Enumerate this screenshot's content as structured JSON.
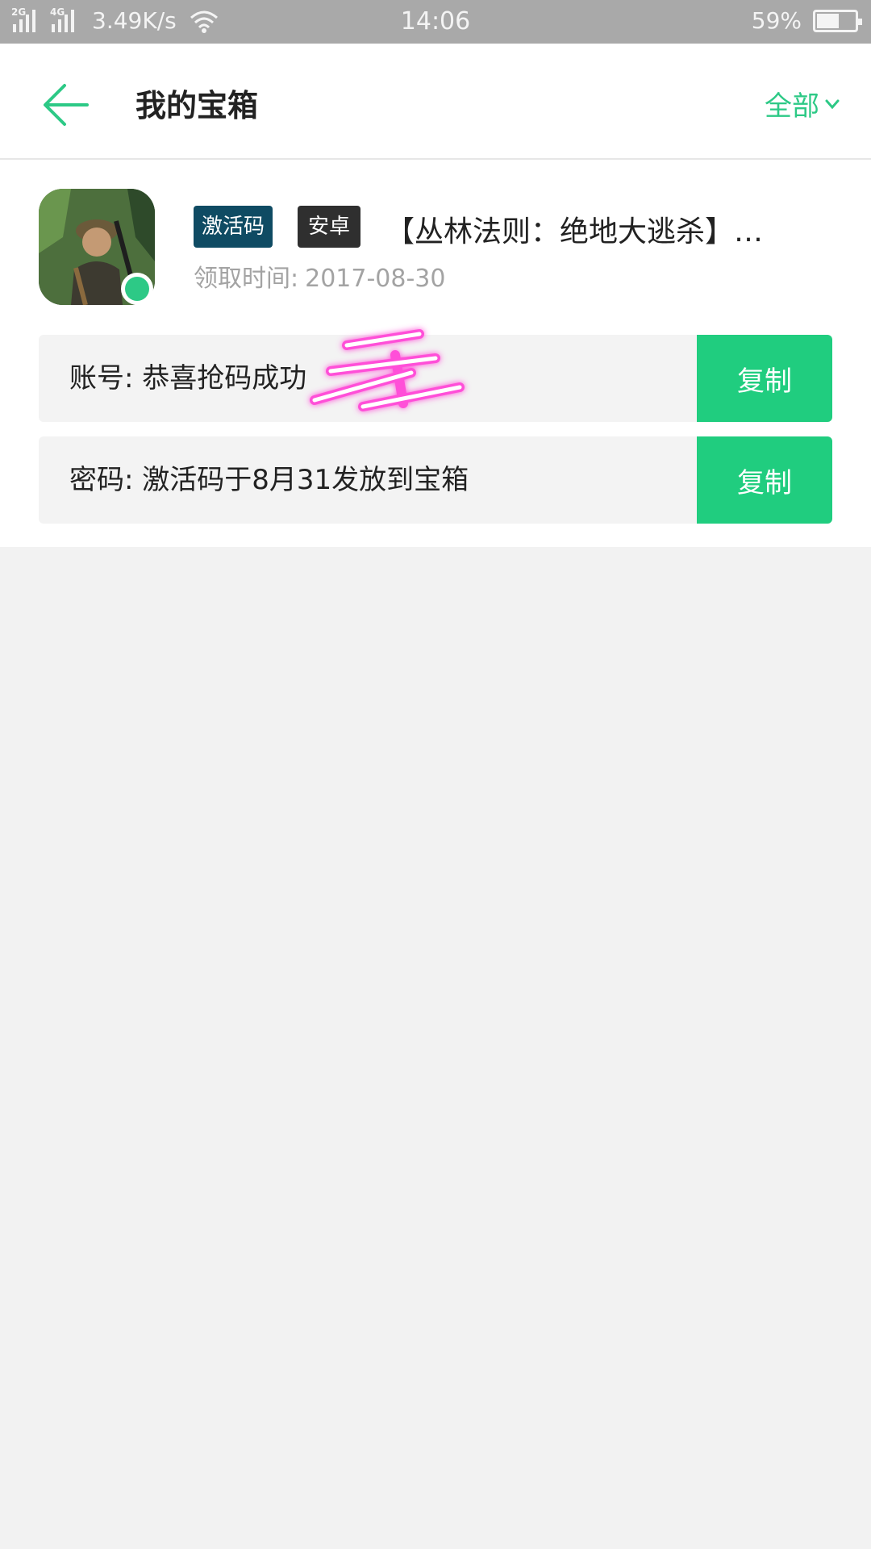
{
  "status_bar": {
    "sim1_label": "2G",
    "sim2_label": "4G",
    "network_speed": "3.49K/s",
    "time": "14:06",
    "battery_percent": "59%",
    "battery_level": 0.59
  },
  "header": {
    "title": "我的宝箱",
    "filter_label": "全部"
  },
  "item": {
    "tag_type": "激活码",
    "tag_platform": "安卓",
    "name": "【丛林法则：绝地大逃杀】…",
    "claim_time_label": "领取时间:",
    "claim_time_value": "2017-08-30",
    "account_label": "账号:",
    "account_value": "恭喜抢码成功",
    "password_label": "密码:",
    "password_value": "激活码于8月31发放到宝箱",
    "copy_label": "复制"
  },
  "colors": {
    "accent": "#2dc986",
    "copy_button": "#20cd7f",
    "tag_activation": "#0f4b63",
    "tag_platform": "#2f2f2f",
    "status_bar": "#a9a9a9",
    "scribble": "#ff4fd8"
  },
  "icons": {
    "back": "arrow-left-icon",
    "filter_chevron": "chevron-down-icon",
    "wifi": "wifi-icon",
    "battery": "battery-icon",
    "platform_badge": "android-badge-icon"
  }
}
